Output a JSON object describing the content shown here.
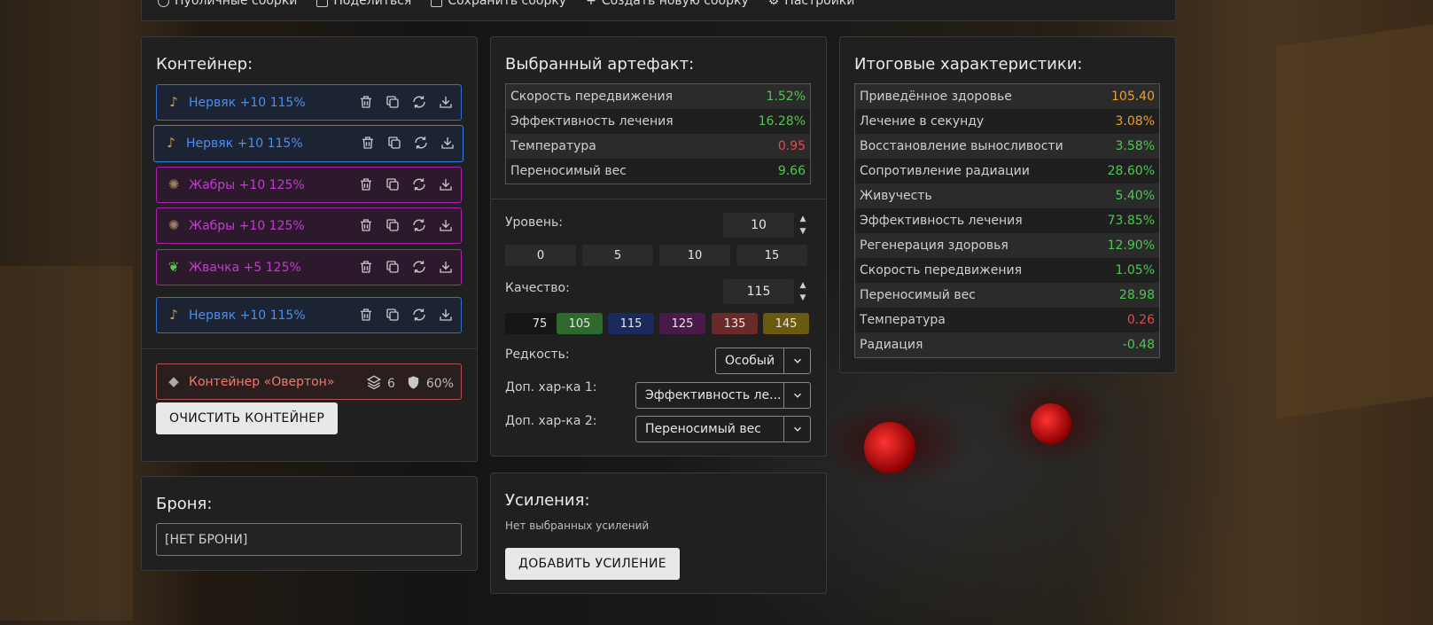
{
  "topbar": {
    "items": [
      "Публичные сборки",
      "Поделиться",
      "Сохранить сборку",
      "Создать новую сборку",
      "Настройки"
    ]
  },
  "container": {
    "title": "Контейнер:",
    "artifacts": [
      {
        "label": "Нервяк +10 115%",
        "color": "blue"
      },
      {
        "label": "Нервяк +10 115%",
        "color": "blue"
      },
      {
        "label": "Жабры +10 125%",
        "color": "purple"
      },
      {
        "label": "Жабры +10 125%",
        "color": "purple"
      },
      {
        "label": "Жвачка +5 125%",
        "color": "purple"
      },
      {
        "label": "Нервяк +10 115%",
        "color": "blue"
      }
    ],
    "container_item": {
      "label": "Контейнер «Овертон»",
      "slots": "6",
      "protection": "60%"
    },
    "clear_button": "ОЧИСТИТЬ КОНТЕЙНЕР"
  },
  "armor": {
    "title": "Броня:",
    "value": "[НЕТ БРОНИ]"
  },
  "artifact": {
    "title": "Выбранный артефакт:",
    "stats": [
      {
        "name": "Скорость передвижения",
        "value": "1.52%",
        "tone": "green"
      },
      {
        "name": "Эффективность лечения",
        "value": "16.28%",
        "tone": "green"
      },
      {
        "name": "Температура",
        "value": "0.95",
        "tone": "red"
      },
      {
        "name": "Переносимый вес",
        "value": "9.66",
        "tone": "green"
      }
    ],
    "level_label": "Уровень:",
    "level_value": "10",
    "level_presets": [
      "0",
      "5",
      "10",
      "15"
    ],
    "quality_label": "Качество:",
    "quality_value": "115",
    "quality_presets": [
      {
        "label": "75",
        "bg": "#161616"
      },
      {
        "label": "105",
        "bg": "#2e6a2e"
      },
      {
        "label": "115",
        "bg": "#1b2a5c"
      },
      {
        "label": "125",
        "bg": "#4a1a4a"
      },
      {
        "label": "135",
        "bg": "#6a2a2a"
      },
      {
        "label": "145",
        "bg": "#6a5a10"
      }
    ],
    "rarity_label": "Редкость:",
    "rarity_value": "Особый",
    "extra1_label": "Доп. хар-ка 1:",
    "extra1_value": "Эффективность ле...",
    "extra2_label": "Доп. хар-ка 2:",
    "extra2_value": "Переносимый вес"
  },
  "boosts": {
    "title": "Усиления:",
    "empty_text": "Нет выбранных усилений",
    "add_button": "ДОБАВИТЬ УСИЛЕНИЕ"
  },
  "totals": {
    "title": "Итоговые характеристики:",
    "stats": [
      {
        "name": "Приведённое здоровье",
        "value": "105.40",
        "tone": "orange"
      },
      {
        "name": "Лечение в секунду",
        "value": "3.08%",
        "tone": "orange"
      },
      {
        "name": "Восстановление выносливости",
        "value": "3.58%",
        "tone": "green"
      },
      {
        "name": "Сопротивление радиации",
        "value": "28.60%",
        "tone": "green"
      },
      {
        "name": "Живучесть",
        "value": "5.40%",
        "tone": "green"
      },
      {
        "name": "Эффективность лечения",
        "value": "73.85%",
        "tone": "green"
      },
      {
        "name": "Регенерация здоровья",
        "value": "12.90%",
        "tone": "green"
      },
      {
        "name": "Скорость передвижения",
        "value": "1.05%",
        "tone": "green"
      },
      {
        "name": "Переносимый вес",
        "value": "28.98",
        "tone": "green"
      },
      {
        "name": "Температура",
        "value": "0.26",
        "tone": "red"
      },
      {
        "name": "Радиация",
        "value": "-0.48",
        "tone": "green"
      }
    ]
  }
}
